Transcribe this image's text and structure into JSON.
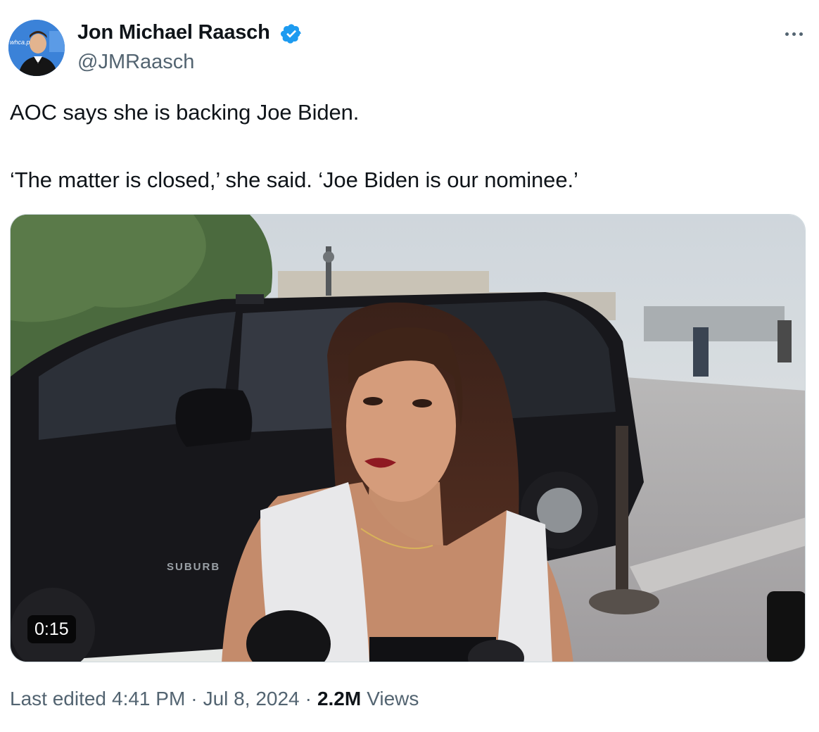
{
  "author": {
    "name": "Jon Michael Raasch",
    "handle": "@JMRaasch",
    "verified": true,
    "avatar_badge_text": "whca.pr"
  },
  "tweet": {
    "text_line_1": "AOC says she is backing Joe Biden.",
    "text_line_2": "‘The matter is closed,’ she said. ‘Joe Biden is our nominee.’"
  },
  "media": {
    "type": "video",
    "duration": "0:15",
    "vehicle_badge_text": "SUBURB"
  },
  "meta": {
    "edited_label": "Last edited",
    "time": "4:41 PM",
    "separator": "·",
    "date": "Jul 8, 2024",
    "views_count": "2.2M",
    "views_label": "Views"
  },
  "colors": {
    "verified_blue": "#1d9bf0",
    "text_primary": "#0f1419",
    "text_secondary": "#536471"
  },
  "icons": {
    "verified": "verified-badge-icon",
    "more": "more-options-icon"
  }
}
